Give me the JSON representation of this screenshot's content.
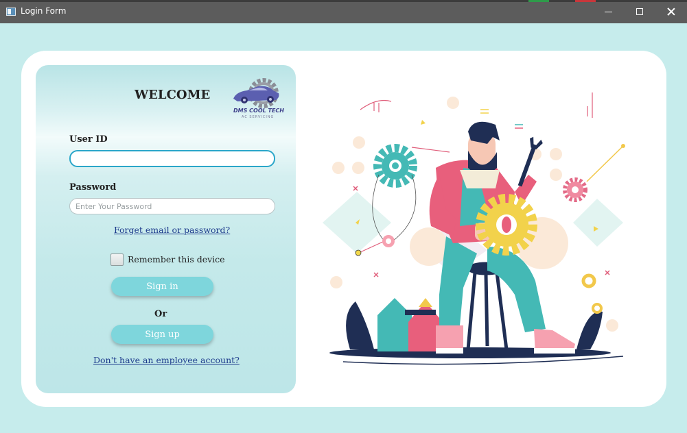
{
  "window": {
    "title": "Login Form"
  },
  "login": {
    "welcome": "WELCOME",
    "logo_text": "DMS COOL TECH",
    "logo_subtext": "AC SERVICING",
    "user_id_label": "User ID",
    "user_id_value": "",
    "password_label": "Password",
    "password_placeholder": "Enter Your Password",
    "forgot_link": "Forget email or password?",
    "remember_label": "Remember this device",
    "remember_checked": false,
    "sign_in_button": "Sign in",
    "or_text": "Or",
    "sign_up_button": "Sign up",
    "no_account_link": "Don't  have an employee account?"
  },
  "colors": {
    "background": "#c6ecec",
    "card": "#ffffff",
    "button": "#7ed6dc",
    "link": "#1d3b8c",
    "focus_border": "#2aa6c9"
  },
  "illustration": {
    "subject": "mechanic-holding-gear-illustration"
  }
}
